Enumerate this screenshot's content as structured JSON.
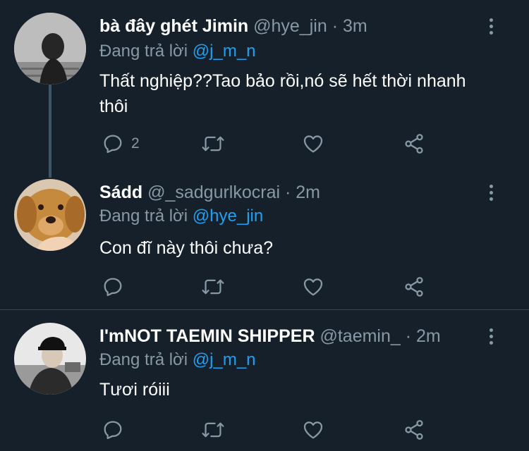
{
  "tweets": [
    {
      "name": "bà đây ghét Jimin",
      "handle": "@hye_jin",
      "dot": "·",
      "time": "3m",
      "replying_prefix": "Đang trả lời",
      "replying_to": "@j_m_n",
      "text": "Thất nghiệp??Tao bảo rồi,nó sẽ hết thời nhanh thôi",
      "reply_count": "2"
    },
    {
      "name": "Sádd",
      "handle": "@_sadgurlkocrai",
      "dot": "·",
      "time": "2m",
      "replying_prefix": "Đang trả lời",
      "replying_to": "@hye_jin",
      "text": "Con đĩ này thôi chưa?",
      "reply_count": ""
    },
    {
      "name": "I'mNOT TAEMIN SHIPPER",
      "handle": "@taemin_",
      "dot": "·",
      "time": "2m",
      "replying_prefix": "Đang trả lời",
      "replying_to": "@j_m_n",
      "text": "Tươi róiii",
      "reply_count": ""
    }
  ],
  "colors": {
    "background": "#15202b",
    "text_secondary": "#8899a6",
    "mention": "#1da1f2",
    "divider": "#38444d"
  },
  "icons": [
    "reply-icon",
    "retweet-icon",
    "like-icon",
    "share-icon",
    "more-options-icon"
  ]
}
